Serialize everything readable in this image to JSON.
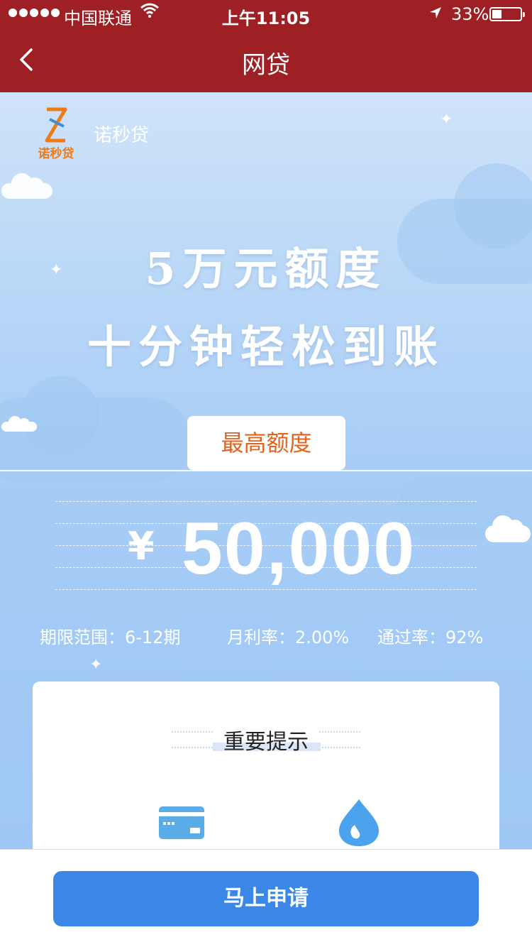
{
  "status_bar": {
    "carrier": "中国联通",
    "time": "上午11:05",
    "battery_percent": "33%",
    "battery_level": 0.33,
    "icons": [
      "signal-dots-icon",
      "wifi-icon",
      "location-arrow-icon",
      "battery-icon"
    ]
  },
  "nav": {
    "title": "网贷",
    "back_icon": "chevron-left-icon"
  },
  "brand": {
    "logo_text": "诺秒贷",
    "name": "诺秒贷",
    "logo_colors": [
      "#f07b16",
      "#3f8fd8"
    ]
  },
  "hero": {
    "slogan_line1": "5万元额度",
    "slogan_line2": "十分钟轻松到账",
    "max_label": "最高额度",
    "currency": "¥",
    "amount": "50,000"
  },
  "stats": {
    "term": "期限范围：6-12期",
    "monthly_rate": "月利率：2.00%",
    "pass_rate": "通过率：92%"
  },
  "notice": {
    "title": "重要提示",
    "icons": [
      "bank-card-icon",
      "water-drop-icon"
    ]
  },
  "cta": {
    "apply_label": "马上申请",
    "color": "#3a87e8"
  },
  "colors": {
    "header_bg": "#9e1f24",
    "accent_orange": "#e5621a",
    "sky_blue": "#a6ccf6"
  }
}
